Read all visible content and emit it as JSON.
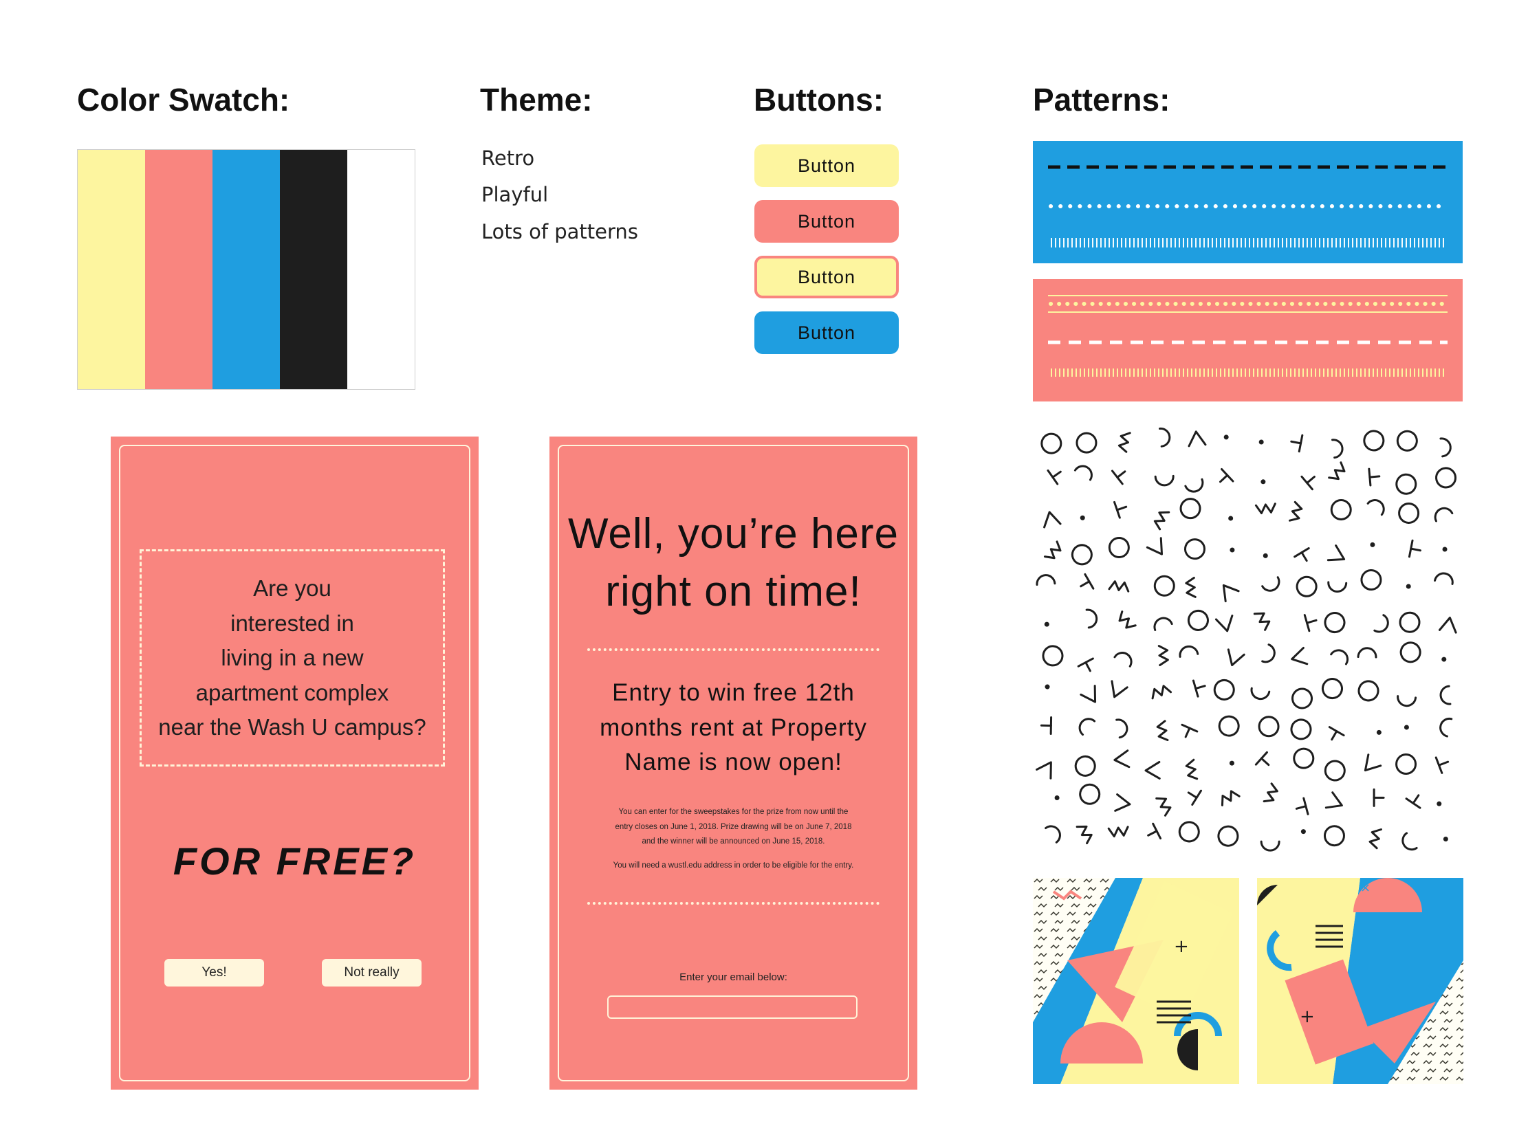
{
  "headings": {
    "color_swatch": "Color Swatch:",
    "theme": "Theme:",
    "buttons": "Buttons:",
    "patterns": "Patterns:"
  },
  "swatch": {
    "colors": [
      "#fdf59f",
      "#f9857f",
      "#1f9ee0",
      "#1e1e1e",
      "#ffffff"
    ]
  },
  "theme": {
    "items": [
      "Retro",
      "Playful",
      "Lots of patterns"
    ]
  },
  "buttons": [
    {
      "label": "Button",
      "style": "yellow"
    },
    {
      "label": "Button",
      "style": "coral"
    },
    {
      "label": "Button",
      "style": "yellow-outlined"
    },
    {
      "label": "Button",
      "style": "blue"
    }
  ],
  "card1": {
    "question_lines": [
      "Are you",
      "interested in",
      "living in a new",
      "apartment complex",
      "near the Wash U campus?"
    ],
    "for_free": "FOR FREE?",
    "yes_button": "Yes!",
    "no_button": "Not really"
  },
  "card2": {
    "headline_lines": [
      "Well, you’re here",
      "right on time!"
    ],
    "subhead_lines": [
      "Entry to win free 12th",
      "months rent at Property",
      "Name is now open!"
    ],
    "fine_print_lines": [
      "You can enter for the sweepstakes for the prize from now until the",
      "entry closes on June 1, 2018. Prize drawing will be on June 7, 2018",
      "and the winner will be announced on June 15, 2018."
    ],
    "eligibility": "You will need a wustl.edu address in order to be eligible for the entry.",
    "email_prompt": "Enter your email below:",
    "email_value": ""
  },
  "colors": {
    "yellow": "#fdf59f",
    "coral": "#f9857f",
    "blue": "#1f9ee0",
    "black": "#1e1e1e",
    "cream": "#fff6dc"
  }
}
